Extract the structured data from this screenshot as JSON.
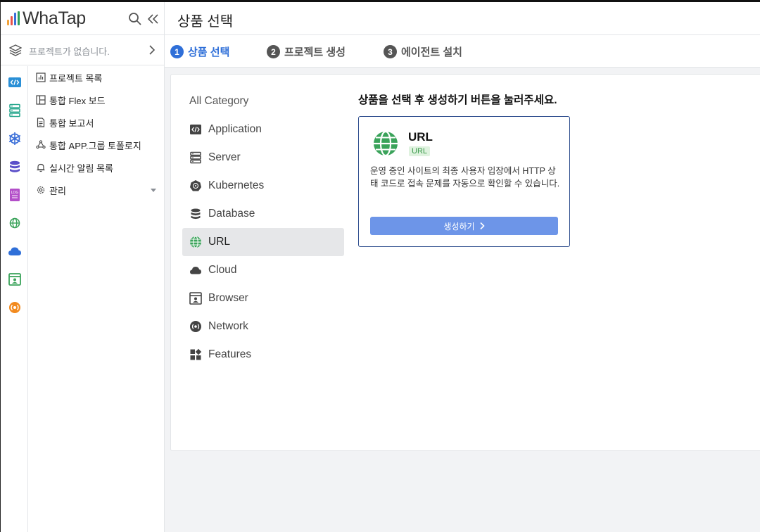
{
  "app": {
    "logo_text": "WhaTap"
  },
  "sidebar": {
    "project_placeholder": "프로젝트가 없습니다.",
    "rail_icons": [
      "application-icon",
      "server-icon",
      "kubernetes-icon",
      "database-icon",
      "log-icon",
      "url-icon",
      "cloud-icon",
      "browser-icon",
      "network-icon"
    ],
    "menu": [
      {
        "label": "프로젝트 목록",
        "icon": "chart-icon"
      },
      {
        "label": "통합 Flex 보드",
        "icon": "board-icon"
      },
      {
        "label": "통합 보고서",
        "icon": "report-icon"
      },
      {
        "label": "통합 APP.그룹 토폴로지",
        "icon": "topology-icon"
      },
      {
        "label": "실시간 알림 목록",
        "icon": "bell-icon"
      },
      {
        "label": "관리",
        "icon": "gear-icon"
      }
    ]
  },
  "page": {
    "title": "상품 선택"
  },
  "steps": [
    {
      "num": "1",
      "label": "상품 선택",
      "active": true
    },
    {
      "num": "2",
      "label": "프로젝트 생성",
      "active": false
    },
    {
      "num": "3",
      "label": "에이전트 설치",
      "active": false
    }
  ],
  "categories": {
    "all_label": "All Category",
    "items": [
      {
        "label": "Application",
        "icon": "application-icon"
      },
      {
        "label": "Server",
        "icon": "server-icon"
      },
      {
        "label": "Kubernetes",
        "icon": "kubernetes-icon"
      },
      {
        "label": "Database",
        "icon": "database-icon"
      },
      {
        "label": "URL",
        "icon": "globe-icon",
        "selected": true
      },
      {
        "label": "Cloud",
        "icon": "cloud-icon"
      },
      {
        "label": "Browser",
        "icon": "browser-icon"
      },
      {
        "label": "Network",
        "icon": "network-icon"
      },
      {
        "label": "Features",
        "icon": "features-icon"
      }
    ]
  },
  "content": {
    "instruction": "상품을 선택 후 생성하기 버튼을 눌러주세요.",
    "card": {
      "title": "URL",
      "badge": "URL",
      "description": "운영 중인 사이트의 최종 사용자 입장에서 HTTP 상태 코드로 접속 문제를 자동으로 확인할 수 있습니다.",
      "button_label": "생성하기"
    }
  },
  "colors": {
    "accent": "#2f6fd8",
    "button": "#6d95e8",
    "card_border": "#2b4b8c",
    "badge_bg": "#dff2df",
    "badge_text": "#3a9a4a"
  }
}
